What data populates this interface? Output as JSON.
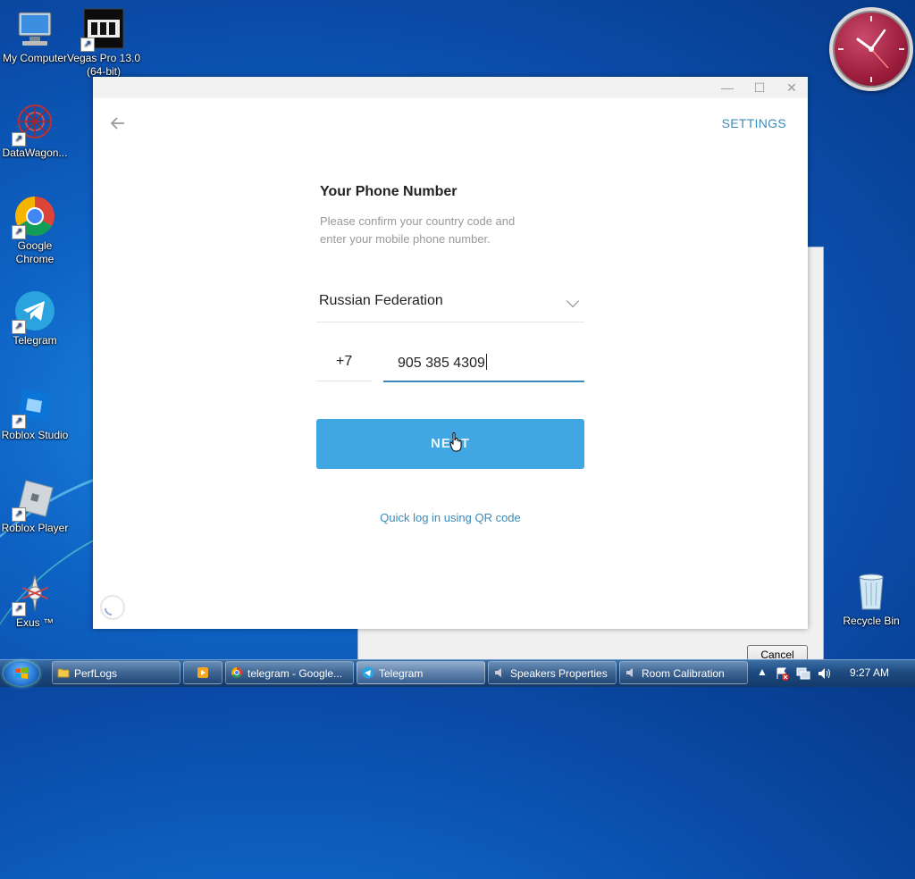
{
  "desktop": {
    "icons": [
      {
        "label": "My Computer"
      },
      {
        "label": "Vegas Pro 13.0 (64-bit)"
      },
      {
        "label": "DataWagon..."
      },
      {
        "label": "Google Chrome"
      },
      {
        "label": "Telegram"
      },
      {
        "label": "Roblox Studio"
      },
      {
        "label": "Roblox Player"
      },
      {
        "label": "Exus ™"
      },
      {
        "label": "Recycle Bin"
      }
    ]
  },
  "background_dialog": {
    "cancel_label": "Cancel"
  },
  "telegram": {
    "settings_label": "SETTINGS",
    "title": "Your Phone Number",
    "description": "Please confirm your country code and enter your mobile phone number.",
    "country": "Russian Federation",
    "country_code": "+7",
    "phone_number": "905 385 4309",
    "next_label": "NEXT",
    "qr_link": "Quick log in using QR code"
  },
  "taskbar": {
    "tasks": [
      {
        "label": "PerfLogs"
      },
      {
        "label": ""
      },
      {
        "label": "telegram - Google..."
      },
      {
        "label": "Telegram"
      },
      {
        "label": "Speakers Properties"
      },
      {
        "label": "Room Calibration"
      }
    ],
    "clock": "9:27 AM"
  },
  "colors": {
    "accent": "#40a7e3",
    "link": "#3a8bbb"
  }
}
